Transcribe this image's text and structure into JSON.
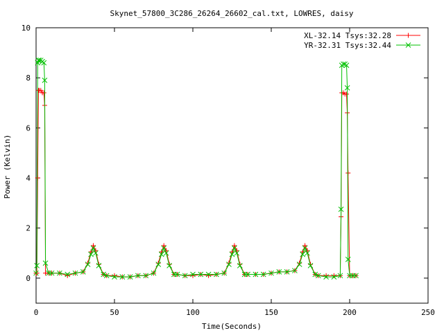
{
  "chart_data": {
    "type": "line",
    "title": "Skynet_57800_3C286_26264_26602_cal.txt, LOWRES, daisy",
    "xlabel": "Time(Seconds)",
    "ylabel": "Power (Kelvin)",
    "xlim": [
      0,
      250
    ],
    "ylim": [
      -1,
      10
    ],
    "xticks": [
      0,
      50,
      100,
      150,
      200,
      250
    ],
    "yticks": [
      0,
      2,
      4,
      6,
      8,
      10
    ],
    "grid": false,
    "legend_position": "top-right",
    "series": [
      {
        "name": "XL-32.14 Tsys:32.28",
        "color": "#ff0000",
        "marker": "plus",
        "x": [
          0,
          0.5,
          1,
          1.5,
          2,
          3,
          4,
          5,
          5.5,
          6,
          8,
          10,
          15,
          20,
          25,
          30,
          33,
          35,
          36.5,
          38,
          40,
          43,
          45,
          50,
          55,
          60,
          65,
          70,
          75,
          78,
          80,
          81.5,
          83,
          85,
          88,
          90,
          95,
          100,
          105,
          110,
          115,
          120,
          123,
          125,
          126.5,
          128,
          130,
          133,
          135,
          140,
          145,
          150,
          155,
          160,
          165,
          168,
          170,
          171.5,
          173,
          175,
          178,
          180,
          185,
          190,
          194,
          194.5,
          195,
          196,
          197,
          198,
          198.5,
          199,
          200,
          202,
          204
        ],
        "y": [
          0.2,
          0.2,
          4.0,
          7.5,
          7.5,
          7.5,
          7.4,
          7.4,
          6.9,
          0.2,
          0.2,
          0.2,
          0.2,
          0.1,
          0.2,
          0.25,
          0.6,
          1.05,
          1.3,
          1.1,
          0.55,
          0.15,
          0.1,
          0.1,
          0.05,
          0.05,
          0.1,
          0.1,
          0.2,
          0.6,
          1.05,
          1.3,
          1.1,
          0.55,
          0.15,
          0.15,
          0.1,
          0.1,
          0.15,
          0.1,
          0.15,
          0.2,
          0.6,
          1.05,
          1.3,
          1.1,
          0.55,
          0.15,
          0.15,
          0.15,
          0.15,
          0.2,
          0.25,
          0.25,
          0.3,
          0.6,
          1.05,
          1.3,
          1.1,
          0.55,
          0.15,
          0.1,
          0.1,
          0.1,
          0.1,
          2.45,
          7.4,
          7.4,
          7.35,
          7.35,
          6.6,
          4.2,
          0.1,
          0.1,
          0.1
        ]
      },
      {
        "name": "YR-32.31 Tsys:32.44",
        "color": "#00c000",
        "marker": "cross",
        "x": [
          0,
          0.5,
          1,
          1.5,
          2,
          3,
          4,
          5,
          5.5,
          6,
          8,
          10,
          15,
          20,
          25,
          30,
          33,
          35,
          36.5,
          38,
          40,
          43,
          45,
          50,
          55,
          60,
          65,
          70,
          75,
          78,
          80,
          81.5,
          83,
          85,
          88,
          90,
          95,
          100,
          105,
          110,
          115,
          120,
          123,
          125,
          126.5,
          128,
          130,
          133,
          135,
          140,
          145,
          150,
          155,
          160,
          165,
          168,
          170,
          171.5,
          173,
          175,
          178,
          180,
          185,
          190,
          194,
          194.5,
          195,
          196,
          197,
          198,
          198.5,
          199,
          200,
          202,
          204
        ],
        "y": [
          0.2,
          0.5,
          8.6,
          8.7,
          8.7,
          8.7,
          8.65,
          8.6,
          7.9,
          0.6,
          0.2,
          0.2,
          0.2,
          0.15,
          0.2,
          0.25,
          0.55,
          0.95,
          1.2,
          1.0,
          0.5,
          0.15,
          0.1,
          0.05,
          0.05,
          0.05,
          0.1,
          0.1,
          0.2,
          0.55,
          0.95,
          1.2,
          1.0,
          0.5,
          0.15,
          0.15,
          0.1,
          0.15,
          0.15,
          0.15,
          0.15,
          0.2,
          0.55,
          0.95,
          1.2,
          1.0,
          0.5,
          0.15,
          0.15,
          0.15,
          0.15,
          0.2,
          0.25,
          0.25,
          0.3,
          0.55,
          0.95,
          1.2,
          1.0,
          0.5,
          0.15,
          0.1,
          0.05,
          0.05,
          0.1,
          2.75,
          8.5,
          8.55,
          8.55,
          8.5,
          7.6,
          0.75,
          0.1,
          0.1,
          0.1
        ]
      }
    ]
  }
}
